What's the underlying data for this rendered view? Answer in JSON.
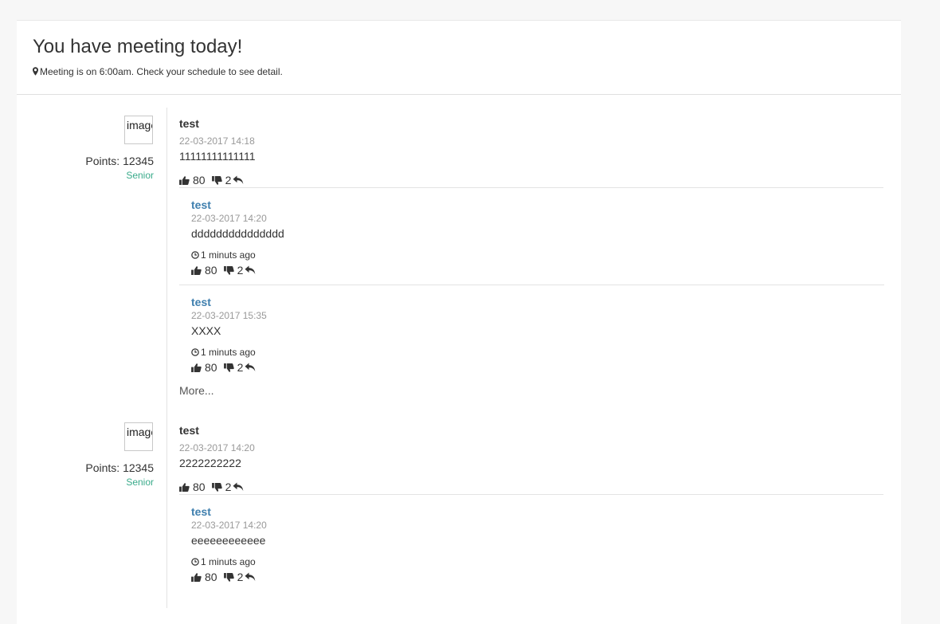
{
  "header": {
    "title": "You have meeting today!",
    "subtitle": "Meeting is on 6:00am. Check your schedule to see detail."
  },
  "icons": {
    "location": "map-marker-icon",
    "like": "thumbs-up-icon",
    "dislike": "thumbs-down-icon",
    "reply": "reply-icon",
    "time": "clock-icon"
  },
  "posts": [
    {
      "avatar_alt": "image",
      "points": "Points: 12345",
      "rank": "Senior",
      "author": "test",
      "timestamp": "22-03-2017 14:18",
      "text": "11111111111111",
      "likes": "80",
      "dislikes": "2",
      "replies": [
        {
          "author": "test",
          "timestamp": "22-03-2017 14:20",
          "text": "ddddddddddddddd",
          "ago": "1 minuts ago",
          "likes": "80",
          "dislikes": "2"
        },
        {
          "author": "test",
          "timestamp": "22-03-2017 15:35",
          "text": "XXXX",
          "ago": "1 minuts ago",
          "likes": "80",
          "dislikes": "2"
        }
      ],
      "more_label": "More..."
    },
    {
      "avatar_alt": "image",
      "points": "Points: 12345",
      "rank": "Senior",
      "author": "test",
      "timestamp": "22-03-2017 14:20",
      "text": "2222222222",
      "likes": "80",
      "dislikes": "2",
      "replies": [
        {
          "author": "test",
          "timestamp": "22-03-2017 14:20",
          "text": "eeeeeeeeeeee",
          "ago": "1 minuts ago",
          "likes": "80",
          "dislikes": "2"
        }
      ]
    }
  ]
}
